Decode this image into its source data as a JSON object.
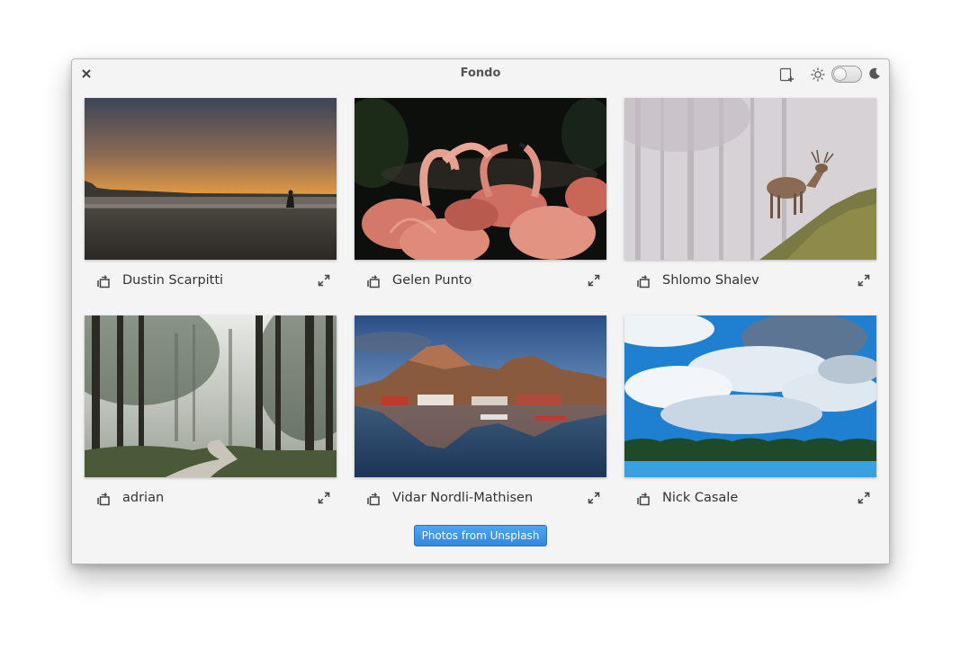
{
  "window": {
    "title": "Fondo",
    "close_icon": "close-icon",
    "header_actions": {
      "new_window_icon": "new-window-icon",
      "light_mode_icon": "sun-icon",
      "dark_mode_toggle": false,
      "dark_mode_icon": "moon-icon"
    }
  },
  "photos": [
    {
      "author": "Dustin Scarpitti",
      "scene": "beach sunset",
      "set_icon": "set-wallpaper-icon",
      "expand_icon": "expand-icon"
    },
    {
      "author": "Gelen Punto",
      "scene": "flamingos",
      "set_icon": "set-wallpaper-icon",
      "expand_icon": "expand-icon"
    },
    {
      "author": "Shlomo Shalev",
      "scene": "deer in fog",
      "set_icon": "set-wallpaper-icon",
      "expand_icon": "expand-icon"
    },
    {
      "author": "adrian",
      "scene": "forest path",
      "set_icon": "set-wallpaper-icon",
      "expand_icon": "expand-icon"
    },
    {
      "author": "Vidar Nordli-Mathisen",
      "scene": "harbor and mountains",
      "set_icon": "set-wallpaper-icon",
      "expand_icon": "expand-icon"
    },
    {
      "author": "Nick Casale",
      "scene": "clouds over lake",
      "set_icon": "set-wallpaper-icon",
      "expand_icon": "expand-icon"
    }
  ],
  "footer": {
    "button_label": "Photos from Unsplash"
  },
  "colors": {
    "accent": "#3689e6",
    "window_bg": "#f4f4f4",
    "text": "#333333"
  }
}
